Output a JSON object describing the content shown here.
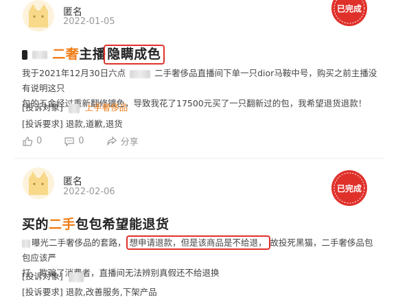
{
  "posts": [
    {
      "author": "匿名",
      "date": "2022-01-05",
      "status": "已完成",
      "title": {
        "prefix": "",
        "highlight": "二奢",
        "middle": "主播",
        "boxed": "隐瞒成色"
      },
      "body_line1_a": "我于2021年12月30日六点",
      "body_line1_b": "二手奢侈品直播间下单一只dior马鞍中号，购买之前主播没有说明这只",
      "body_line2": "包的五金经过重新翻修镀色，导致我花了17500元买了一只翻新过的包，我希望退货退款！",
      "target_label": "[投诉对象]",
      "target_value": "上手奢侈品",
      "demand_label": "[投诉要求]",
      "demand_value": "退款,道歉,退货",
      "likes": "0",
      "comments": "0",
      "shares": "分享"
    },
    {
      "author": "匿名",
      "date": "2022-02-06",
      "status": "已完成",
      "title": {
        "prefix": "买的",
        "highlight": "二手",
        "rest": "包包希望能退货"
      },
      "body_line1_a": "曝光二手奢侈品的套路，",
      "body_line1_boxed": "想申请退款，但是该商品是不给退，",
      "body_line1_b": "故投死黑猫，二手奢侈品包包应该严",
      "body_line2": "打，欺骗了消费者，直播间无法辨别真假还不给退换",
      "target_label": "[投诉对象]",
      "target_value": "",
      "demand_label": "[投诉要求]",
      "demand_value": "退款,改善服务,下架产品"
    }
  ],
  "colors": {
    "accent": "#f07c17",
    "stamp": "#e0302a",
    "box": "#e0302a",
    "avatar": "#f8d98a"
  },
  "icons": {
    "avatar": "cat-avatar-icon",
    "stamp": "completed-stamp-icon",
    "like": "thumbs-up-icon",
    "comment": "comment-icon",
    "share": "share-icon"
  }
}
